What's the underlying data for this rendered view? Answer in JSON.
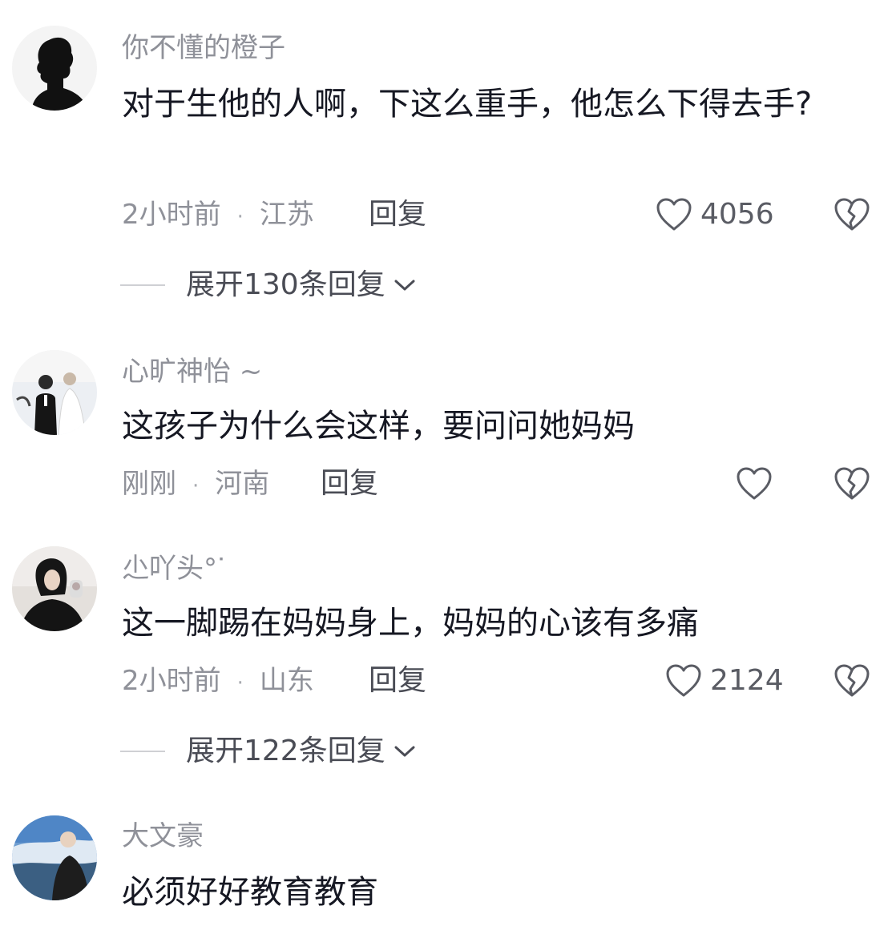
{
  "comments": [
    {
      "username": "你不懂的橙子",
      "text": "对于生他的人啊，下这么重手，他怎么下得去手?",
      "time": "2小时前",
      "location": "江苏",
      "reply_label": "回复",
      "likes": "4056",
      "expand_label": "展开130条回复",
      "avatar_icon": "silhouette-avatar"
    },
    {
      "username": "心旷神怡 ~",
      "text": "这孩子为什么会这样，要问问她妈妈",
      "time": "刚刚",
      "location": "河南",
      "reply_label": "回复",
      "likes": "",
      "avatar_icon": "couple-photo-avatar"
    },
    {
      "username": "尐吖头°ᐝ",
      "text": "这一脚踢在妈妈身上，妈妈的心该有多痛",
      "time": "2小时前",
      "location": "山东",
      "reply_label": "回复",
      "likes": "2124",
      "expand_label": "展开122条回复",
      "avatar_icon": "girl-photo-avatar"
    },
    {
      "username": "大文豪",
      "text": "必须好好教育教育",
      "avatar_icon": "sky-photo-avatar"
    }
  ],
  "icons": {
    "like": "heart-outline-icon",
    "dislike": "broken-heart-icon",
    "expand": "chevron-down-icon"
  },
  "colors": {
    "text": "#161823",
    "secondary": "#8f9199",
    "icon": "#5a5c64"
  }
}
